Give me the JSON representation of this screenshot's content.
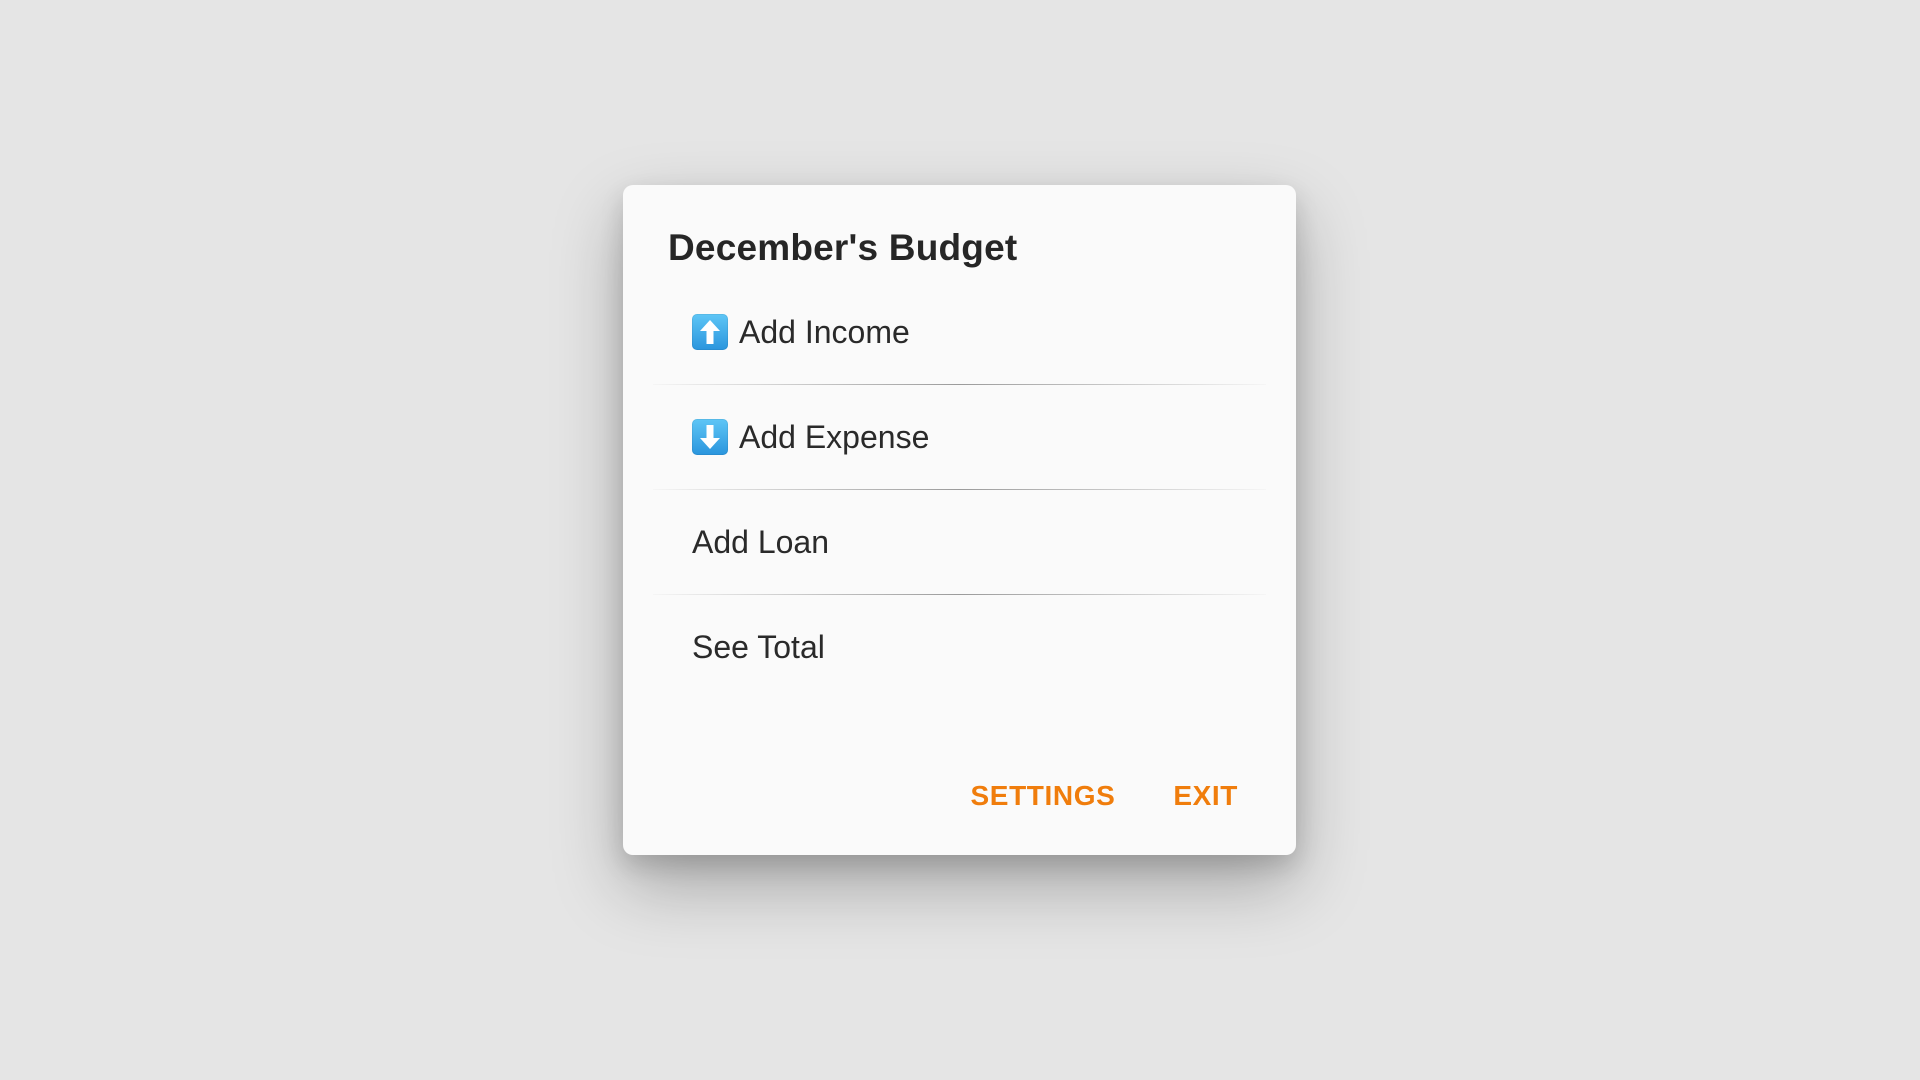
{
  "dialog": {
    "title": "December's Budget",
    "items": [
      {
        "label": "Add Income",
        "icon": "up-arrow-icon"
      },
      {
        "label": "Add Expense",
        "icon": "down-arrow-icon"
      },
      {
        "label": "Add Loan"
      },
      {
        "label": "See Total"
      }
    ],
    "actions": {
      "settings_label": "SETTINGS",
      "exit_label": "EXIT"
    }
  },
  "colors": {
    "accent": "#f07d0c",
    "background": "#e5e5e5",
    "surface": "#fafafa",
    "icon_blue": "#2a95dd"
  }
}
